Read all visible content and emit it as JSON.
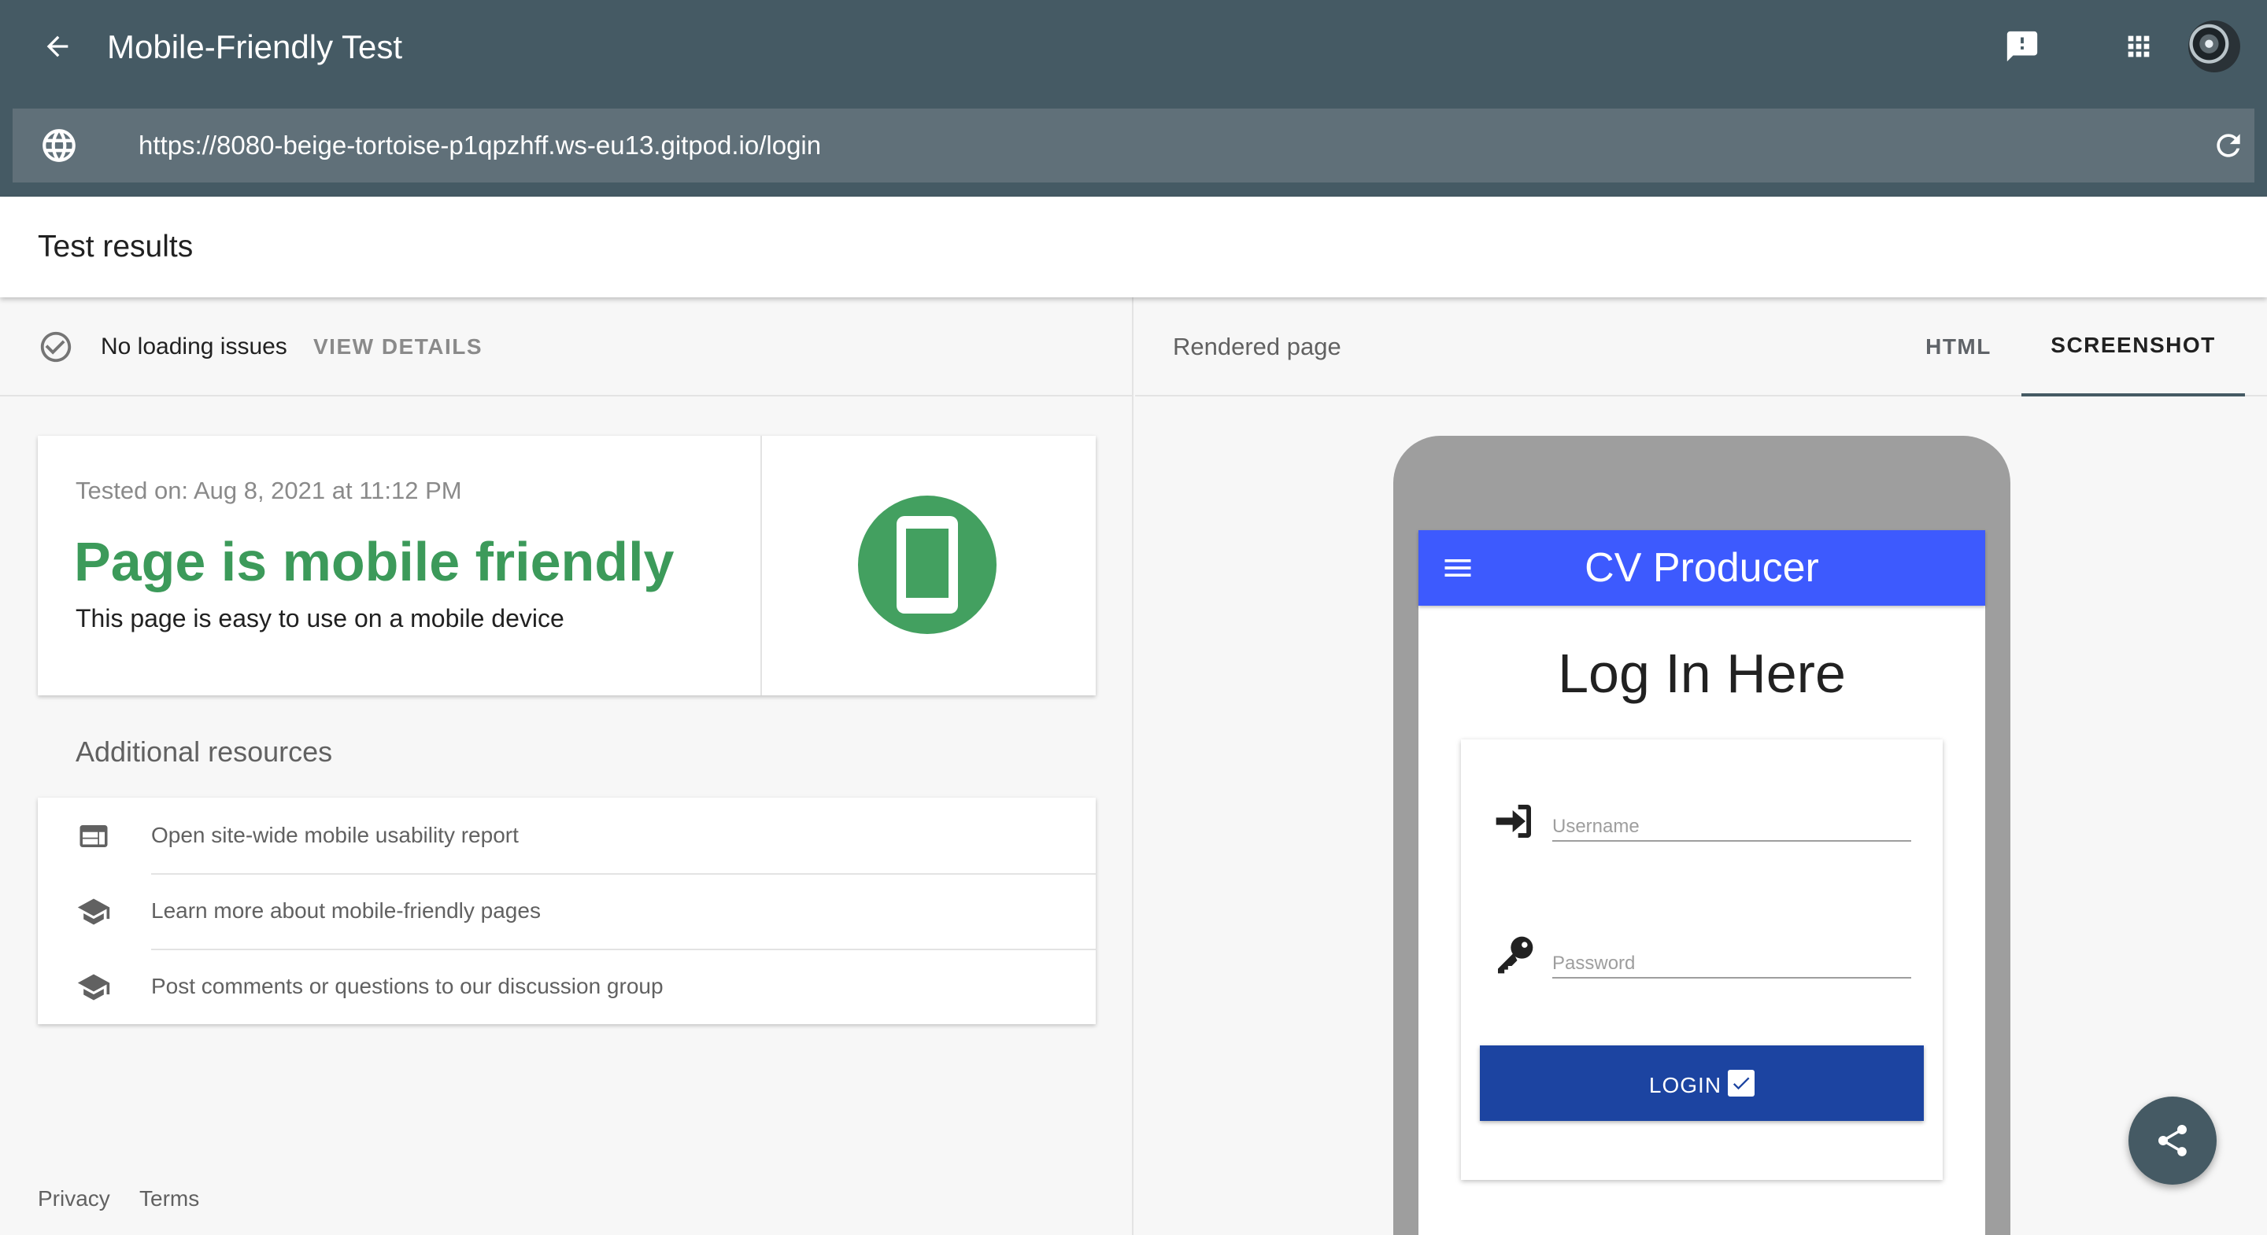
{
  "appbar": {
    "title": "Mobile-Friendly Test",
    "url": "https://8080-beige-tortoise-p1qpzhff.ws-eu13.gitpod.io/login"
  },
  "results": {
    "title": "Test results",
    "status_text": "No loading issues",
    "view_details_label": "VIEW DETAILS",
    "tested_on": "Tested on: Aug 8, 2021 at 11:12 PM",
    "verdict": "Page is mobile friendly",
    "verdict_sub": "This page is easy to use on a mobile device"
  },
  "resources": {
    "heading": "Additional resources",
    "items": [
      {
        "label": "Open site-wide mobile usability report",
        "icon": "web-layout-icon"
      },
      {
        "label": "Learn more about mobile-friendly pages",
        "icon": "school-icon"
      },
      {
        "label": "Post comments or questions to our discussion group",
        "icon": "school-icon"
      }
    ]
  },
  "footer": {
    "privacy": "Privacy",
    "terms": "Terms"
  },
  "rendered": {
    "label": "Rendered page",
    "tabs": [
      {
        "label": "HTML",
        "active": false
      },
      {
        "label": "SCREENSHOT",
        "active": true
      }
    ]
  },
  "preview": {
    "app_title": "CV Producer",
    "heading": "Log In Here",
    "username_label": "Username",
    "password_label": "Password",
    "login_label": "LOGIN"
  },
  "colors": {
    "appbar": "#455a64",
    "url_bar": "#607079",
    "success_green": "#3c9a5a",
    "preview_bar": "#3d5afe",
    "login_button": "#1c44a1"
  }
}
